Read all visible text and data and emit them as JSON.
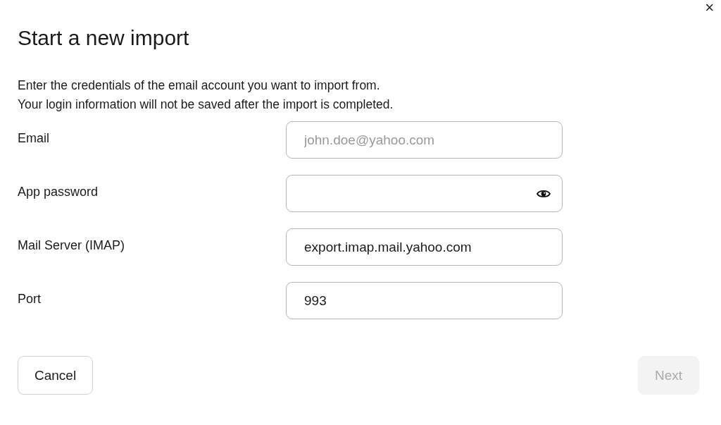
{
  "dialog": {
    "close": "×",
    "title": "Start a new import",
    "description": [
      "Enter the credentials of the email account you want to import from.",
      "Your login information will not be saved after the import is completed."
    ]
  },
  "fields": [
    {
      "label": "Email",
      "kind": "text",
      "placeholder": "john.doe@yahoo.com"
    },
    {
      "label": "App password",
      "kind": "password"
    },
    {
      "label": "Mail Server (IMAP)",
      "kind": "text",
      "value": "export.imap.mail.yahoo.com"
    },
    {
      "label": "Port",
      "kind": "text",
      "value": "993"
    }
  ],
  "buttons": {
    "cancel": {
      "label": "Cancel",
      "disabled": false
    },
    "next": {
      "label": "Next",
      "disabled": true
    }
  }
}
